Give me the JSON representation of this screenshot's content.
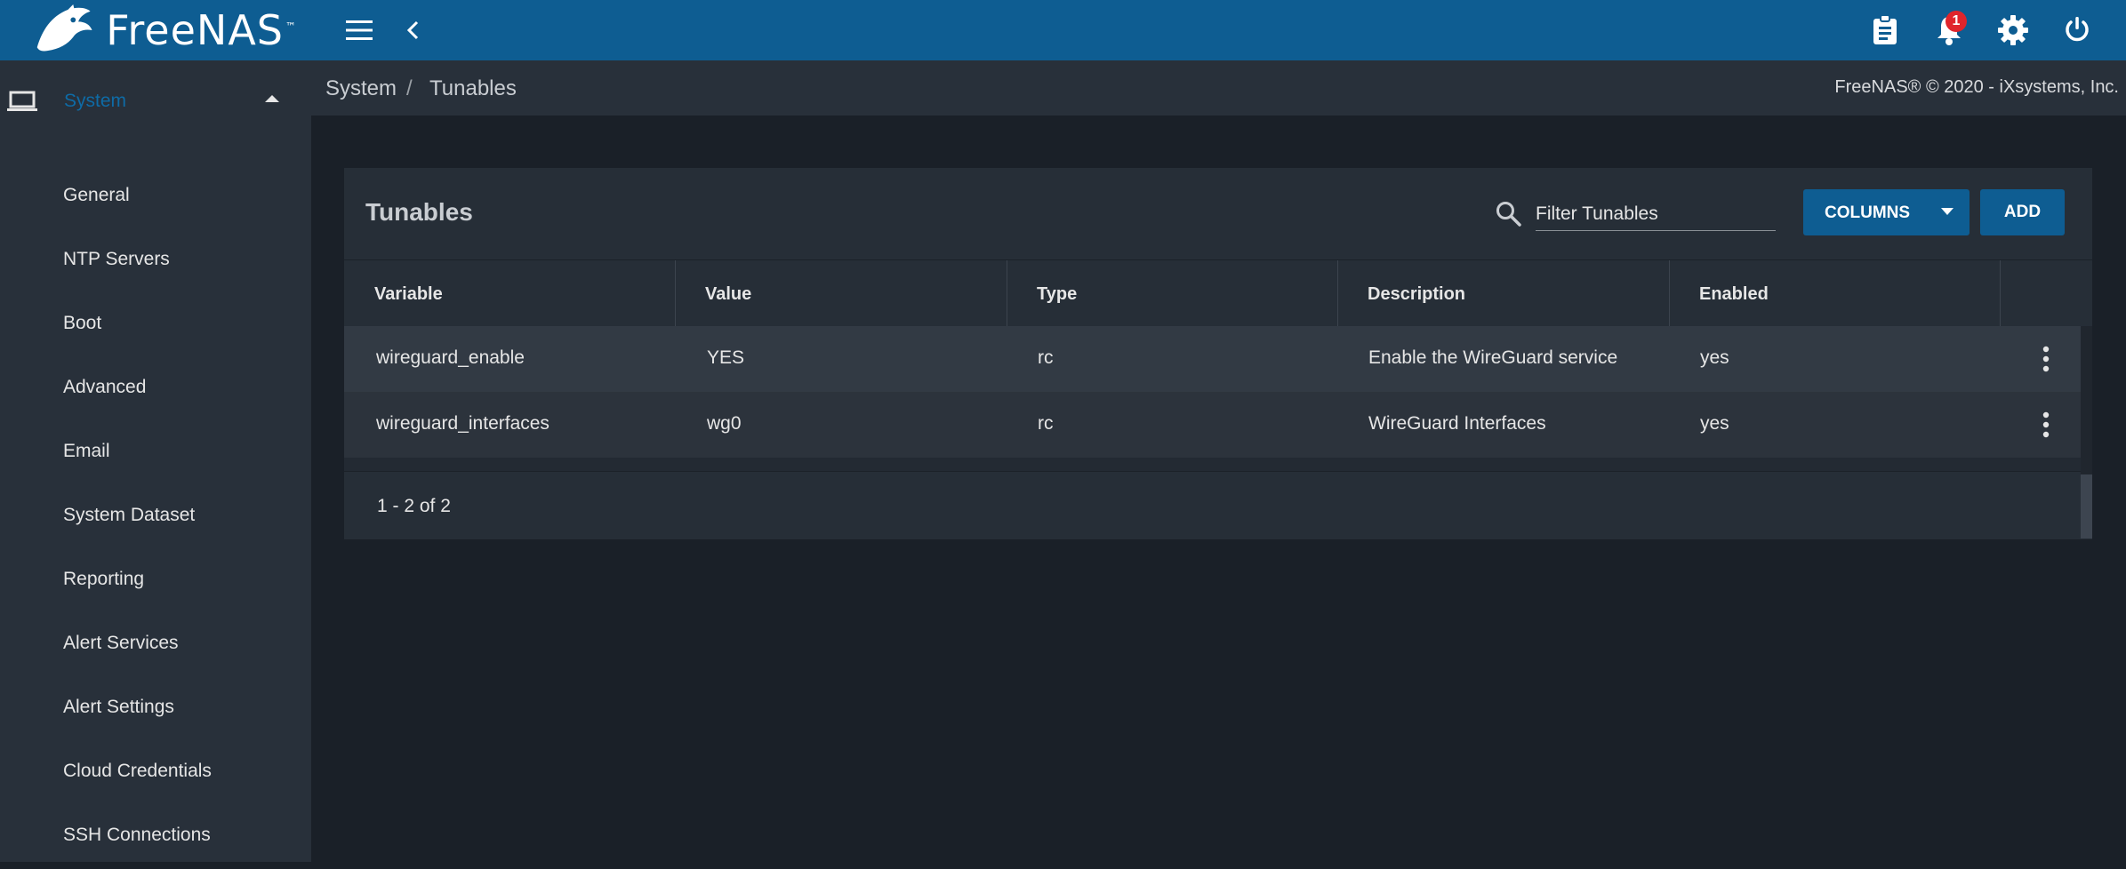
{
  "app": {
    "logo_text": "FreeNAS",
    "logo_tm": "™",
    "notification_count": "1"
  },
  "sidebar": {
    "parent_label": "System",
    "items": [
      {
        "label": "General"
      },
      {
        "label": "NTP Servers"
      },
      {
        "label": "Boot"
      },
      {
        "label": "Advanced"
      },
      {
        "label": "Email"
      },
      {
        "label": "System Dataset"
      },
      {
        "label": "Reporting"
      },
      {
        "label": "Alert Services"
      },
      {
        "label": "Alert Settings"
      },
      {
        "label": "Cloud Credentials"
      },
      {
        "label": "SSH Connections"
      }
    ]
  },
  "breadcrumb": {
    "parent": "System",
    "separator": "/",
    "current": "Tunables"
  },
  "copyright": "FreeNAS® © 2020 - iXsystems, Inc.",
  "card": {
    "title": "Tunables",
    "filter_placeholder": "Filter Tunables",
    "columns_label": "COLUMNS",
    "add_label": "ADD",
    "headers": [
      "Variable",
      "Value",
      "Type",
      "Description",
      "Enabled"
    ],
    "rows": [
      [
        "wireguard_enable",
        "YES",
        "rc",
        "Enable the WireGuard service",
        "yes"
      ],
      [
        "wireguard_interfaces",
        "wg0",
        "rc",
        "WireGuard Interfaces",
        "yes"
      ]
    ],
    "pager": "1 - 2 of 2"
  },
  "colors": {
    "topbar": "#0e5d92",
    "accent": "#0e6ba6",
    "background": "#1a2028",
    "badge": "#e0252c"
  }
}
